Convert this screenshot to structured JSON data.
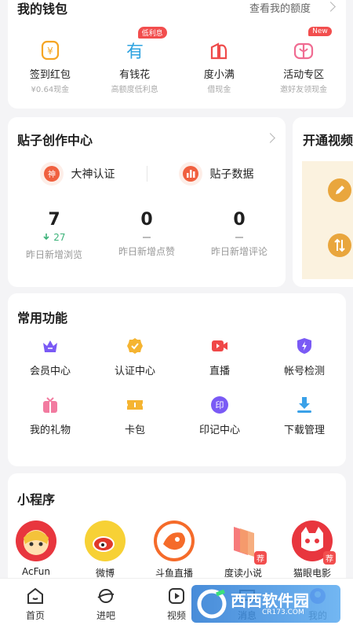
{
  "wallet": {
    "title": "我的钱包",
    "link": "查看我的额度",
    "items": [
      {
        "label": "签到红包",
        "sub": "¥0.64现金",
        "badge": "",
        "icon": "yuan-coin-icon"
      },
      {
        "label": "有钱花",
        "sub": "高额度低利息",
        "badge": "低利息",
        "icon": "you-qian-hua-icon"
      },
      {
        "label": "度小满",
        "sub": "借现金",
        "badge": "",
        "icon": "du-xiao-man-icon"
      },
      {
        "label": "活动专区",
        "sub": "邀好友领现金",
        "badge": "New",
        "icon": "gift-icon"
      }
    ]
  },
  "creator": {
    "title": "贴子创作中心",
    "actions": [
      {
        "label": "大神认证",
        "icon_char": "神",
        "icon": "god-cert-icon"
      },
      {
        "label": "贴子数据",
        "icon": "bar-chart-icon"
      }
    ],
    "stats": [
      {
        "value": "7",
        "delta": "27",
        "label": "昨日新增浏览"
      },
      {
        "value": "0",
        "delta": "",
        "label": "昨日新增点赞"
      },
      {
        "value": "0",
        "delta": "",
        "label": "昨日新增评论"
      }
    ]
  },
  "video_card": {
    "title": "开通视频"
  },
  "functions": {
    "title": "常用功能",
    "items": [
      {
        "label": "会员中心",
        "icon": "crown-icon",
        "color": "#7a5af5"
      },
      {
        "label": "认证中心",
        "icon": "badge-check-icon",
        "color": "#f5b431"
      },
      {
        "label": "直播",
        "icon": "video-camera-icon",
        "color": "#f04848"
      },
      {
        "label": "帐号检测",
        "icon": "shield-bolt-icon",
        "color": "#7a5af5"
      },
      {
        "label": "我的礼物",
        "icon": "gift-box-icon",
        "color": "#f27ba0"
      },
      {
        "label": "卡包",
        "icon": "ticket-icon",
        "color": "#f5b431"
      },
      {
        "label": "印记中心",
        "icon": "seal-icon",
        "color": "#7a5af5",
        "char": "印"
      },
      {
        "label": "下载管理",
        "icon": "download-icon",
        "color": "#3aa1e8"
      }
    ]
  },
  "mini_programs": {
    "title": "小程序",
    "items": [
      {
        "label": "AcFun",
        "icon": "acfun-logo",
        "rec": ""
      },
      {
        "label": "微博",
        "icon": "weibo-logo",
        "rec": ""
      },
      {
        "label": "斗鱼直播",
        "icon": "douyu-logo",
        "rec": ""
      },
      {
        "label": "度读小说",
        "icon": "dudu-logo",
        "rec": "荐"
      },
      {
        "label": "猫眼电影",
        "icon": "maoyan-logo",
        "rec": "荐"
      }
    ]
  },
  "nav": [
    {
      "label": "首页",
      "icon": "home-icon"
    },
    {
      "label": "进吧",
      "icon": "planet-icon"
    },
    {
      "label": "视频",
      "icon": "play-icon"
    },
    {
      "label": "消息",
      "icon": "message-icon"
    },
    {
      "label": "我的",
      "icon": "profile-icon"
    }
  ],
  "watermark": {
    "main": "西西软件园",
    "sub": "CR173.COM"
  }
}
